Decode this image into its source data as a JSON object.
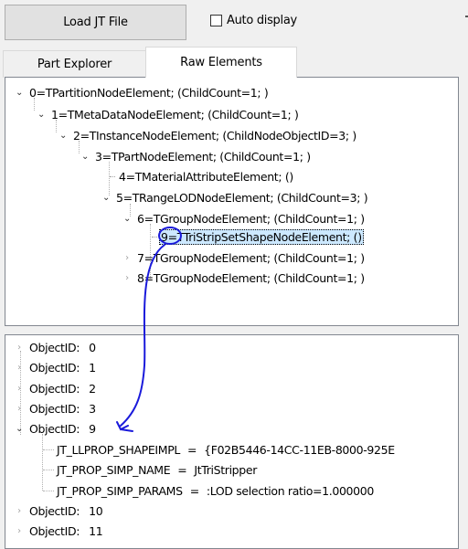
{
  "toolbar": {
    "load_button_label": "Load JT File",
    "auto_display_label": "Auto display",
    "auto_display_checked": false
  },
  "tabs": [
    {
      "label": "Part Explorer",
      "active": false
    },
    {
      "label": "Raw Elements",
      "active": true
    }
  ],
  "tree": {
    "nodes": [
      {
        "label": "0=TPartitionNodeElement; (ChildCount=1; )",
        "expanded": true
      },
      {
        "label": "1=TMetaDataNodeElement; (ChildCount=1; )",
        "expanded": true
      },
      {
        "label": "2=TInstanceNodeElement; (ChildNodeObjectID=3; )",
        "expanded": true
      },
      {
        "label": "3=TPartNodeElement; (ChildCount=1; )",
        "expanded": true
      },
      {
        "label": "4=TMaterialAttributeElement; ()",
        "expanded": null
      },
      {
        "label": "5=TRangeLODNodeElement; (ChildCount=3; )",
        "expanded": true
      },
      {
        "label": "6=TGroupNodeElement; (ChildCount=1; )",
        "expanded": true
      },
      {
        "label": "9=TTriStripSetShapeNodeElement; ()",
        "expanded": null,
        "selected": true
      },
      {
        "label": "7=TGroupNodeElement; (ChildCount=1; )",
        "expanded": false
      },
      {
        "label": "8=TGroupNodeElement; (ChildCount=1; )",
        "expanded": false
      }
    ]
  },
  "objects": {
    "rows": [
      {
        "label": "ObjectID:",
        "value": "0",
        "expanded": false
      },
      {
        "label": "ObjectID:",
        "value": "1",
        "expanded": false
      },
      {
        "label": "ObjectID:",
        "value": "2",
        "expanded": false
      },
      {
        "label": "ObjectID:",
        "value": "3",
        "expanded": false
      },
      {
        "label": "ObjectID:",
        "value": "9",
        "expanded": true
      },
      {
        "label": "ObjectID:",
        "value": "10",
        "expanded": false
      },
      {
        "label": "ObjectID:",
        "value": "11",
        "expanded": false
      }
    ],
    "properties": [
      {
        "key": "JT_LLPROP_SHAPEIMPL",
        "value": "{F02B5446-14CC-11EB-8000-925E"
      },
      {
        "key": "JT_PROP_SIMP_NAME",
        "value": "JtTriStripper"
      },
      {
        "key": "JT_PROP_SIMP_PARAMS",
        "value": ":LOD selection ratio=1.000000"
      }
    ]
  },
  "colors": {
    "selection": "#cce8ff",
    "annotation": "#1a1adb",
    "panel_border": "#828790"
  }
}
